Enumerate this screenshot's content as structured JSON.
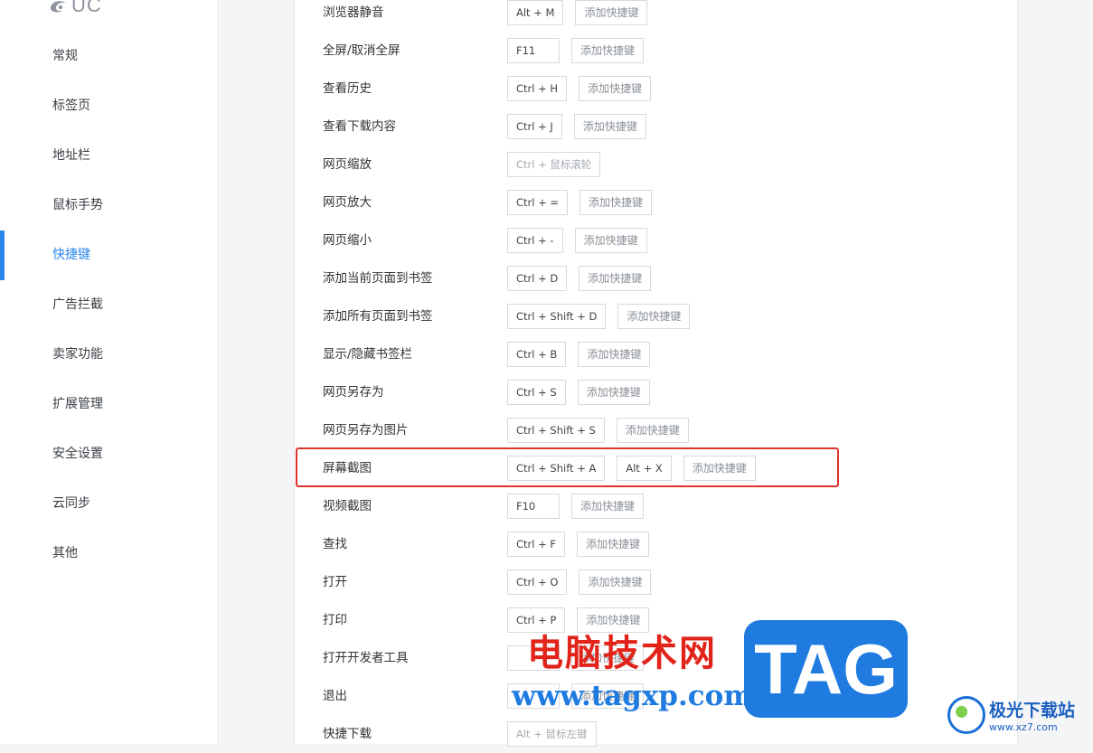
{
  "sidebar": {
    "logo_text": "UC",
    "items": [
      "常规",
      "标签页",
      "地址栏",
      "鼠标手势",
      "快捷键",
      "广告拦截",
      "卖家功能",
      "扩展管理",
      "安全设置",
      "云同步",
      "其他"
    ],
    "active_index": 4
  },
  "shortcuts": {
    "add_label": "添加快捷键",
    "rows": [
      {
        "label": "浏览器静音",
        "keys": [
          "Alt + M"
        ],
        "add": true
      },
      {
        "label": "全屏/取消全屏",
        "keys": [
          "F11"
        ],
        "add": true
      },
      {
        "label": "查看历史",
        "keys": [
          "Ctrl + H"
        ],
        "add": true
      },
      {
        "label": "查看下载内容",
        "keys": [
          "Ctrl + J"
        ],
        "add": true
      },
      {
        "label": "网页缩放",
        "keys": [
          "Ctrl + 鼠标滚轮"
        ],
        "add": false,
        "fixed": true
      },
      {
        "label": "网页放大",
        "keys": [
          "Ctrl + ="
        ],
        "add": true
      },
      {
        "label": "网页缩小",
        "keys": [
          "Ctrl + -"
        ],
        "add": true
      },
      {
        "label": "添加当前页面到书签",
        "keys": [
          "Ctrl + D"
        ],
        "add": true
      },
      {
        "label": "添加所有页面到书签",
        "keys": [
          "Ctrl + Shift + D"
        ],
        "add": true
      },
      {
        "label": "显示/隐藏书签栏",
        "keys": [
          "Ctrl + B"
        ],
        "add": true
      },
      {
        "label": "网页另存为",
        "keys": [
          "Ctrl + S"
        ],
        "add": true
      },
      {
        "label": "网页另存为图片",
        "keys": [
          "Ctrl + Shift + S"
        ],
        "add": true
      },
      {
        "label": "屏幕截图",
        "keys": [
          "Ctrl + Shift + A",
          "Alt + X"
        ],
        "add": true
      },
      {
        "label": "视频截图",
        "keys": [
          "F10"
        ],
        "add": true
      },
      {
        "label": "查找",
        "keys": [
          "Ctrl + F"
        ],
        "add": true
      },
      {
        "label": "打开",
        "keys": [
          "Ctrl + O"
        ],
        "add": true
      },
      {
        "label": "打印",
        "keys": [
          "Ctrl + P"
        ],
        "add": true
      },
      {
        "label": "打开开发者工具",
        "keys": [
          ""
        ],
        "add": true
      },
      {
        "label": "退出",
        "keys": [
          ""
        ],
        "add": true
      },
      {
        "label": "快捷下载",
        "keys": [
          "Alt + 鼠标左键"
        ],
        "add": false,
        "fixed": true
      }
    ],
    "highlighted_index": 12
  },
  "watermark": {
    "cn_text": "电脑技术网",
    "url": "www.tagxp.com",
    "tag": "TAG",
    "corner_title": "极光下载站",
    "corner_url": "www.xz7.com"
  },
  "colors": {
    "accent": "#2a86e8",
    "highlight": "#e0332e",
    "watermark_red": "#e2231a",
    "watermark_blue": "#1f7be0"
  }
}
